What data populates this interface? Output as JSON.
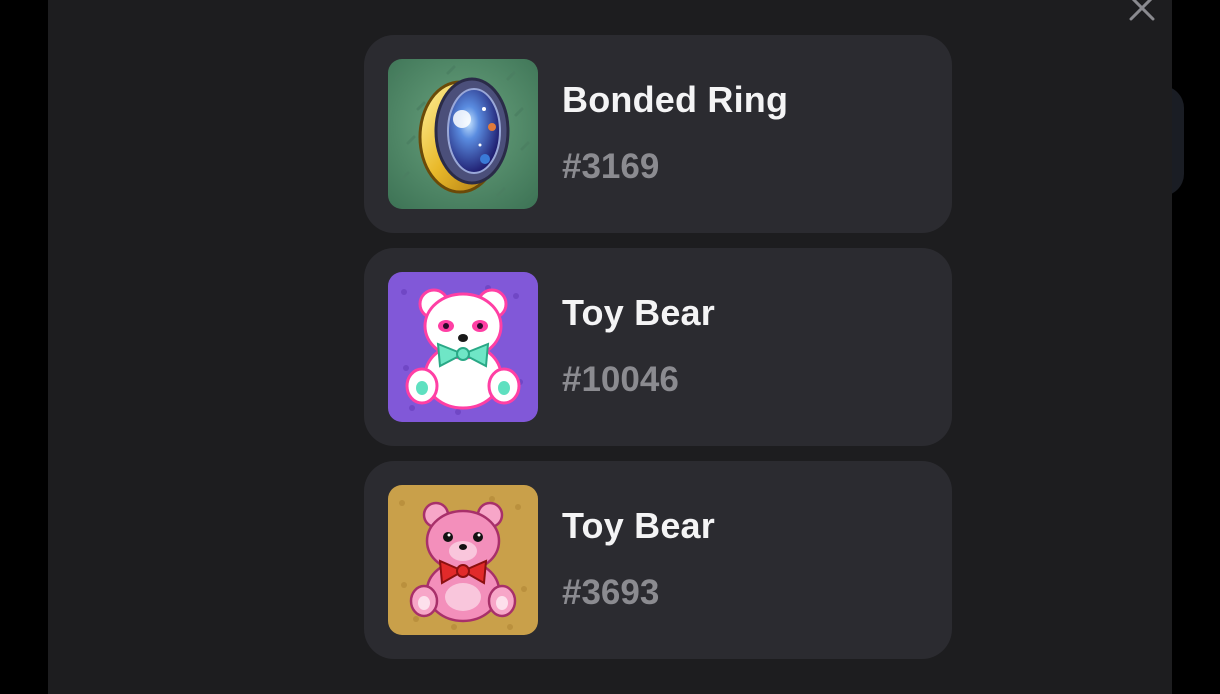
{
  "modal": {
    "close_icon": "close-icon",
    "items": [
      {
        "name": "Bonded Ring",
        "number": "#3169",
        "icon": "bonded-ring-icon",
        "bg": "#4f8a67"
      },
      {
        "name": "Toy Bear",
        "number": "#10046",
        "icon": "white-toy-bear-icon",
        "bg": "#8158d8"
      },
      {
        "name": "Toy Bear",
        "number": "#3693",
        "icon": "pink-toy-bear-icon",
        "bg": "#c9a04a"
      }
    ]
  }
}
